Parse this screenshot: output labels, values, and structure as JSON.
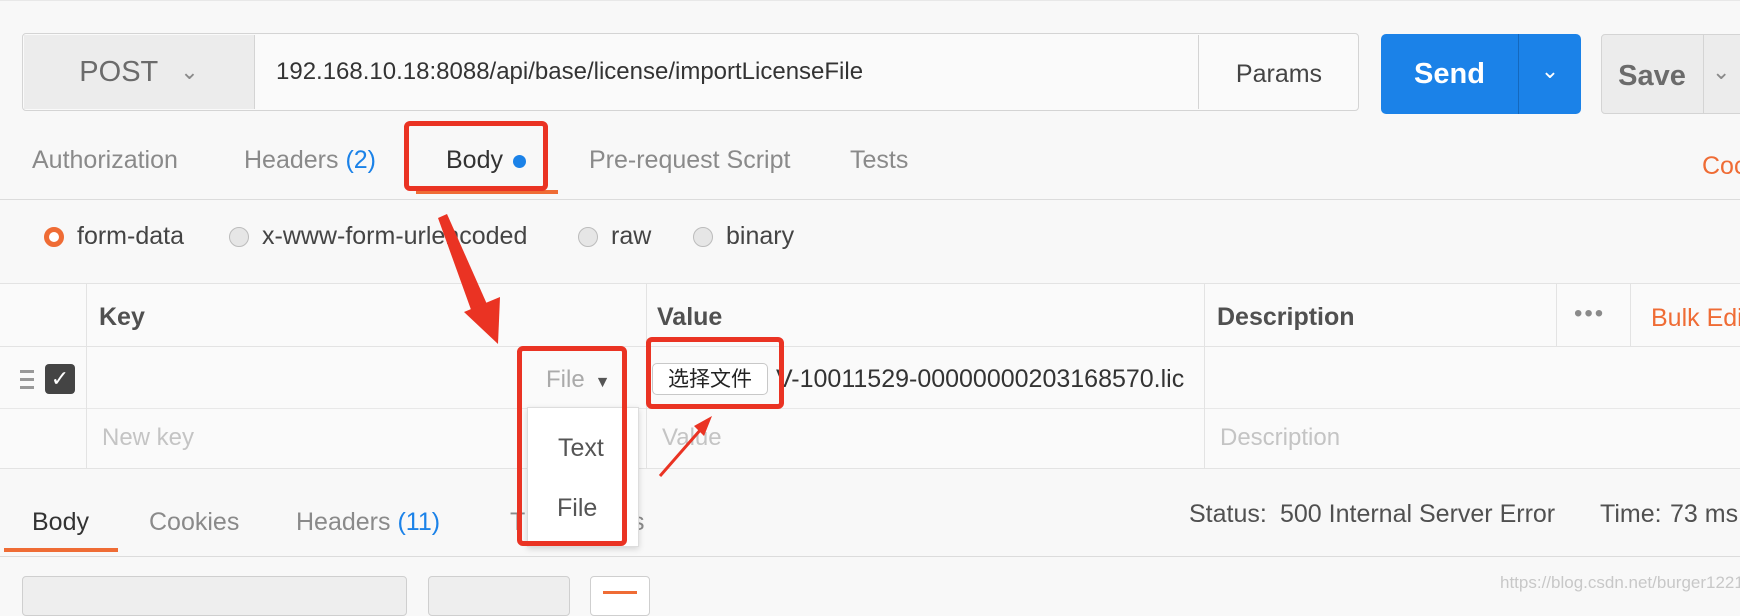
{
  "request": {
    "method": "POST",
    "url": "192.168.10.18:8088/api/base/license/importLicenseFile",
    "params_label": "Params",
    "send_label": "Send",
    "save_label": "Save"
  },
  "request_tabs": {
    "authorization": "Authorization",
    "headers": "Headers",
    "headers_count": "(2)",
    "body": "Body",
    "prerequest": "Pre-request Script",
    "tests": "Tests",
    "code_partial": "Coc"
  },
  "body_modes": [
    "form-data",
    "x-www-form-urlencoded",
    "raw",
    "binary"
  ],
  "body_mode_selected": "form-data",
  "table": {
    "headers": {
      "key": "Key",
      "value": "Value",
      "description": "Description",
      "bulk_edit": "Bulk Edi"
    },
    "row": {
      "checked": true,
      "type": "File",
      "file_button": "选择文件",
      "file_name": "V-10011529-00000000203168570.lic"
    },
    "new_row": {
      "key_placeholder": "New key",
      "value_placeholder": "Value",
      "description_placeholder": "Description"
    }
  },
  "type_menu": [
    "Text",
    "File"
  ],
  "response_tabs": {
    "body": "Body",
    "cookies": "Cookies",
    "headers": "Headers",
    "headers_count": "(11)",
    "tests_partial": "T",
    "tests_tail": "s"
  },
  "response_status": {
    "status_label": "Status:",
    "status_value": "500 Internal Server Error",
    "time_label": "Time:",
    "time_value": "73 ms"
  },
  "watermark": "https://blog.csdn.net/burger1221",
  "colors": {
    "accent_orange": "#ef6c35",
    "send_blue": "#1b82e8",
    "annotation_red": "#ea3323"
  }
}
